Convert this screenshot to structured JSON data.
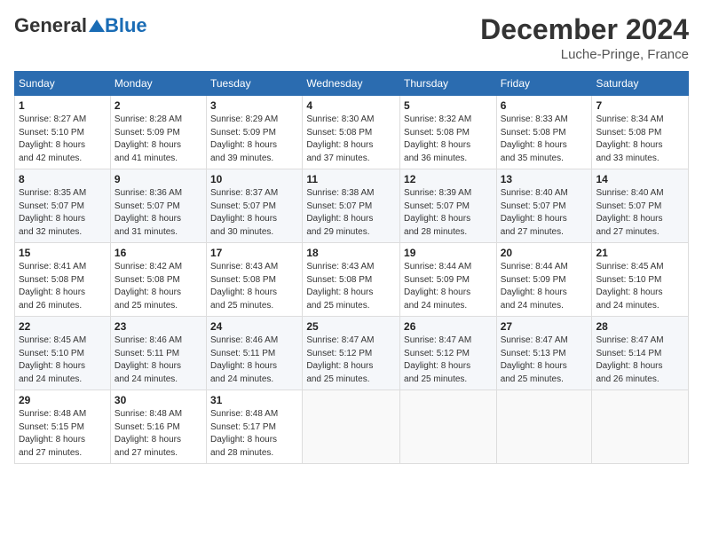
{
  "header": {
    "logo_general": "General",
    "logo_blue": "Blue",
    "month_title": "December 2024",
    "location": "Luche-Pringe, France"
  },
  "weekdays": [
    "Sunday",
    "Monday",
    "Tuesday",
    "Wednesday",
    "Thursday",
    "Friday",
    "Saturday"
  ],
  "weeks": [
    [
      {
        "day": "1",
        "detail": "Sunrise: 8:27 AM\nSunset: 5:10 PM\nDaylight: 8 hours\nand 42 minutes."
      },
      {
        "day": "2",
        "detail": "Sunrise: 8:28 AM\nSunset: 5:09 PM\nDaylight: 8 hours\nand 41 minutes."
      },
      {
        "day": "3",
        "detail": "Sunrise: 8:29 AM\nSunset: 5:09 PM\nDaylight: 8 hours\nand 39 minutes."
      },
      {
        "day": "4",
        "detail": "Sunrise: 8:30 AM\nSunset: 5:08 PM\nDaylight: 8 hours\nand 37 minutes."
      },
      {
        "day": "5",
        "detail": "Sunrise: 8:32 AM\nSunset: 5:08 PM\nDaylight: 8 hours\nand 36 minutes."
      },
      {
        "day": "6",
        "detail": "Sunrise: 8:33 AM\nSunset: 5:08 PM\nDaylight: 8 hours\nand 35 minutes."
      },
      {
        "day": "7",
        "detail": "Sunrise: 8:34 AM\nSunset: 5:08 PM\nDaylight: 8 hours\nand 33 minutes."
      }
    ],
    [
      {
        "day": "8",
        "detail": "Sunrise: 8:35 AM\nSunset: 5:07 PM\nDaylight: 8 hours\nand 32 minutes."
      },
      {
        "day": "9",
        "detail": "Sunrise: 8:36 AM\nSunset: 5:07 PM\nDaylight: 8 hours\nand 31 minutes."
      },
      {
        "day": "10",
        "detail": "Sunrise: 8:37 AM\nSunset: 5:07 PM\nDaylight: 8 hours\nand 30 minutes."
      },
      {
        "day": "11",
        "detail": "Sunrise: 8:38 AM\nSunset: 5:07 PM\nDaylight: 8 hours\nand 29 minutes."
      },
      {
        "day": "12",
        "detail": "Sunrise: 8:39 AM\nSunset: 5:07 PM\nDaylight: 8 hours\nand 28 minutes."
      },
      {
        "day": "13",
        "detail": "Sunrise: 8:40 AM\nSunset: 5:07 PM\nDaylight: 8 hours\nand 27 minutes."
      },
      {
        "day": "14",
        "detail": "Sunrise: 8:40 AM\nSunset: 5:07 PM\nDaylight: 8 hours\nand 27 minutes."
      }
    ],
    [
      {
        "day": "15",
        "detail": "Sunrise: 8:41 AM\nSunset: 5:08 PM\nDaylight: 8 hours\nand 26 minutes."
      },
      {
        "day": "16",
        "detail": "Sunrise: 8:42 AM\nSunset: 5:08 PM\nDaylight: 8 hours\nand 25 minutes."
      },
      {
        "day": "17",
        "detail": "Sunrise: 8:43 AM\nSunset: 5:08 PM\nDaylight: 8 hours\nand 25 minutes."
      },
      {
        "day": "18",
        "detail": "Sunrise: 8:43 AM\nSunset: 5:08 PM\nDaylight: 8 hours\nand 25 minutes."
      },
      {
        "day": "19",
        "detail": "Sunrise: 8:44 AM\nSunset: 5:09 PM\nDaylight: 8 hours\nand 24 minutes."
      },
      {
        "day": "20",
        "detail": "Sunrise: 8:44 AM\nSunset: 5:09 PM\nDaylight: 8 hours\nand 24 minutes."
      },
      {
        "day": "21",
        "detail": "Sunrise: 8:45 AM\nSunset: 5:10 PM\nDaylight: 8 hours\nand 24 minutes."
      }
    ],
    [
      {
        "day": "22",
        "detail": "Sunrise: 8:45 AM\nSunset: 5:10 PM\nDaylight: 8 hours\nand 24 minutes."
      },
      {
        "day": "23",
        "detail": "Sunrise: 8:46 AM\nSunset: 5:11 PM\nDaylight: 8 hours\nand 24 minutes."
      },
      {
        "day": "24",
        "detail": "Sunrise: 8:46 AM\nSunset: 5:11 PM\nDaylight: 8 hours\nand 24 minutes."
      },
      {
        "day": "25",
        "detail": "Sunrise: 8:47 AM\nSunset: 5:12 PM\nDaylight: 8 hours\nand 25 minutes."
      },
      {
        "day": "26",
        "detail": "Sunrise: 8:47 AM\nSunset: 5:12 PM\nDaylight: 8 hours\nand 25 minutes."
      },
      {
        "day": "27",
        "detail": "Sunrise: 8:47 AM\nSunset: 5:13 PM\nDaylight: 8 hours\nand 25 minutes."
      },
      {
        "day": "28",
        "detail": "Sunrise: 8:47 AM\nSunset: 5:14 PM\nDaylight: 8 hours\nand 26 minutes."
      }
    ],
    [
      {
        "day": "29",
        "detail": "Sunrise: 8:48 AM\nSunset: 5:15 PM\nDaylight: 8 hours\nand 27 minutes."
      },
      {
        "day": "30",
        "detail": "Sunrise: 8:48 AM\nSunset: 5:16 PM\nDaylight: 8 hours\nand 27 minutes."
      },
      {
        "day": "31",
        "detail": "Sunrise: 8:48 AM\nSunset: 5:17 PM\nDaylight: 8 hours\nand 28 minutes."
      },
      {
        "day": "",
        "detail": ""
      },
      {
        "day": "",
        "detail": ""
      },
      {
        "day": "",
        "detail": ""
      },
      {
        "day": "",
        "detail": ""
      }
    ]
  ]
}
